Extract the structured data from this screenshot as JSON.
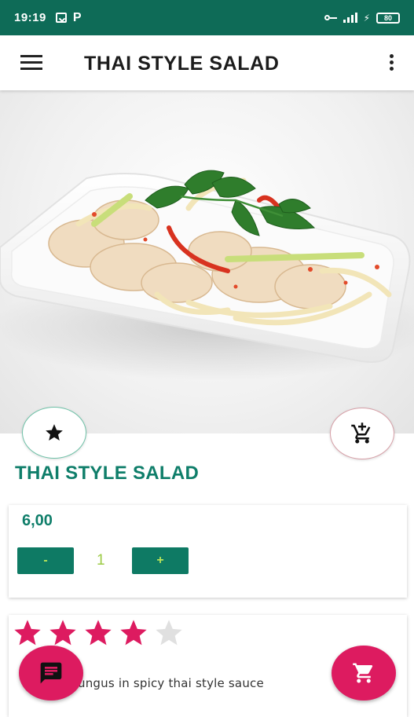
{
  "status_bar": {
    "time": "19:19",
    "p_label": "P",
    "battery": "80",
    "icons": [
      "download-icon",
      "key-icon",
      "signal-icon",
      "battery-icon"
    ]
  },
  "app_bar": {
    "title": "THAI STYLE SALAD",
    "icons": [
      "menu-icon",
      "more-vert-icon"
    ]
  },
  "product": {
    "title": "THAI STYLE SALAD",
    "price": "6,00",
    "quantity": "1",
    "minus_label": "-",
    "plus_label": "+",
    "rating": 4,
    "rating_max": 5,
    "description_visible": "ungus in spicy thai style sauce"
  },
  "actions": {
    "favorite_icon": "star-icon",
    "add_to_cart_icon": "add-shopping-cart-icon",
    "chat_icon": "chat-icon",
    "cart_icon": "shopping-cart-icon"
  },
  "colors": {
    "status_bar": "#0e6b57",
    "accent_green": "#0f7e6a",
    "quantity_text": "#9ccb45",
    "pink": "#dd1b60",
    "star_filled": "#dd1b60",
    "star_empty": "#e0e0e0"
  }
}
